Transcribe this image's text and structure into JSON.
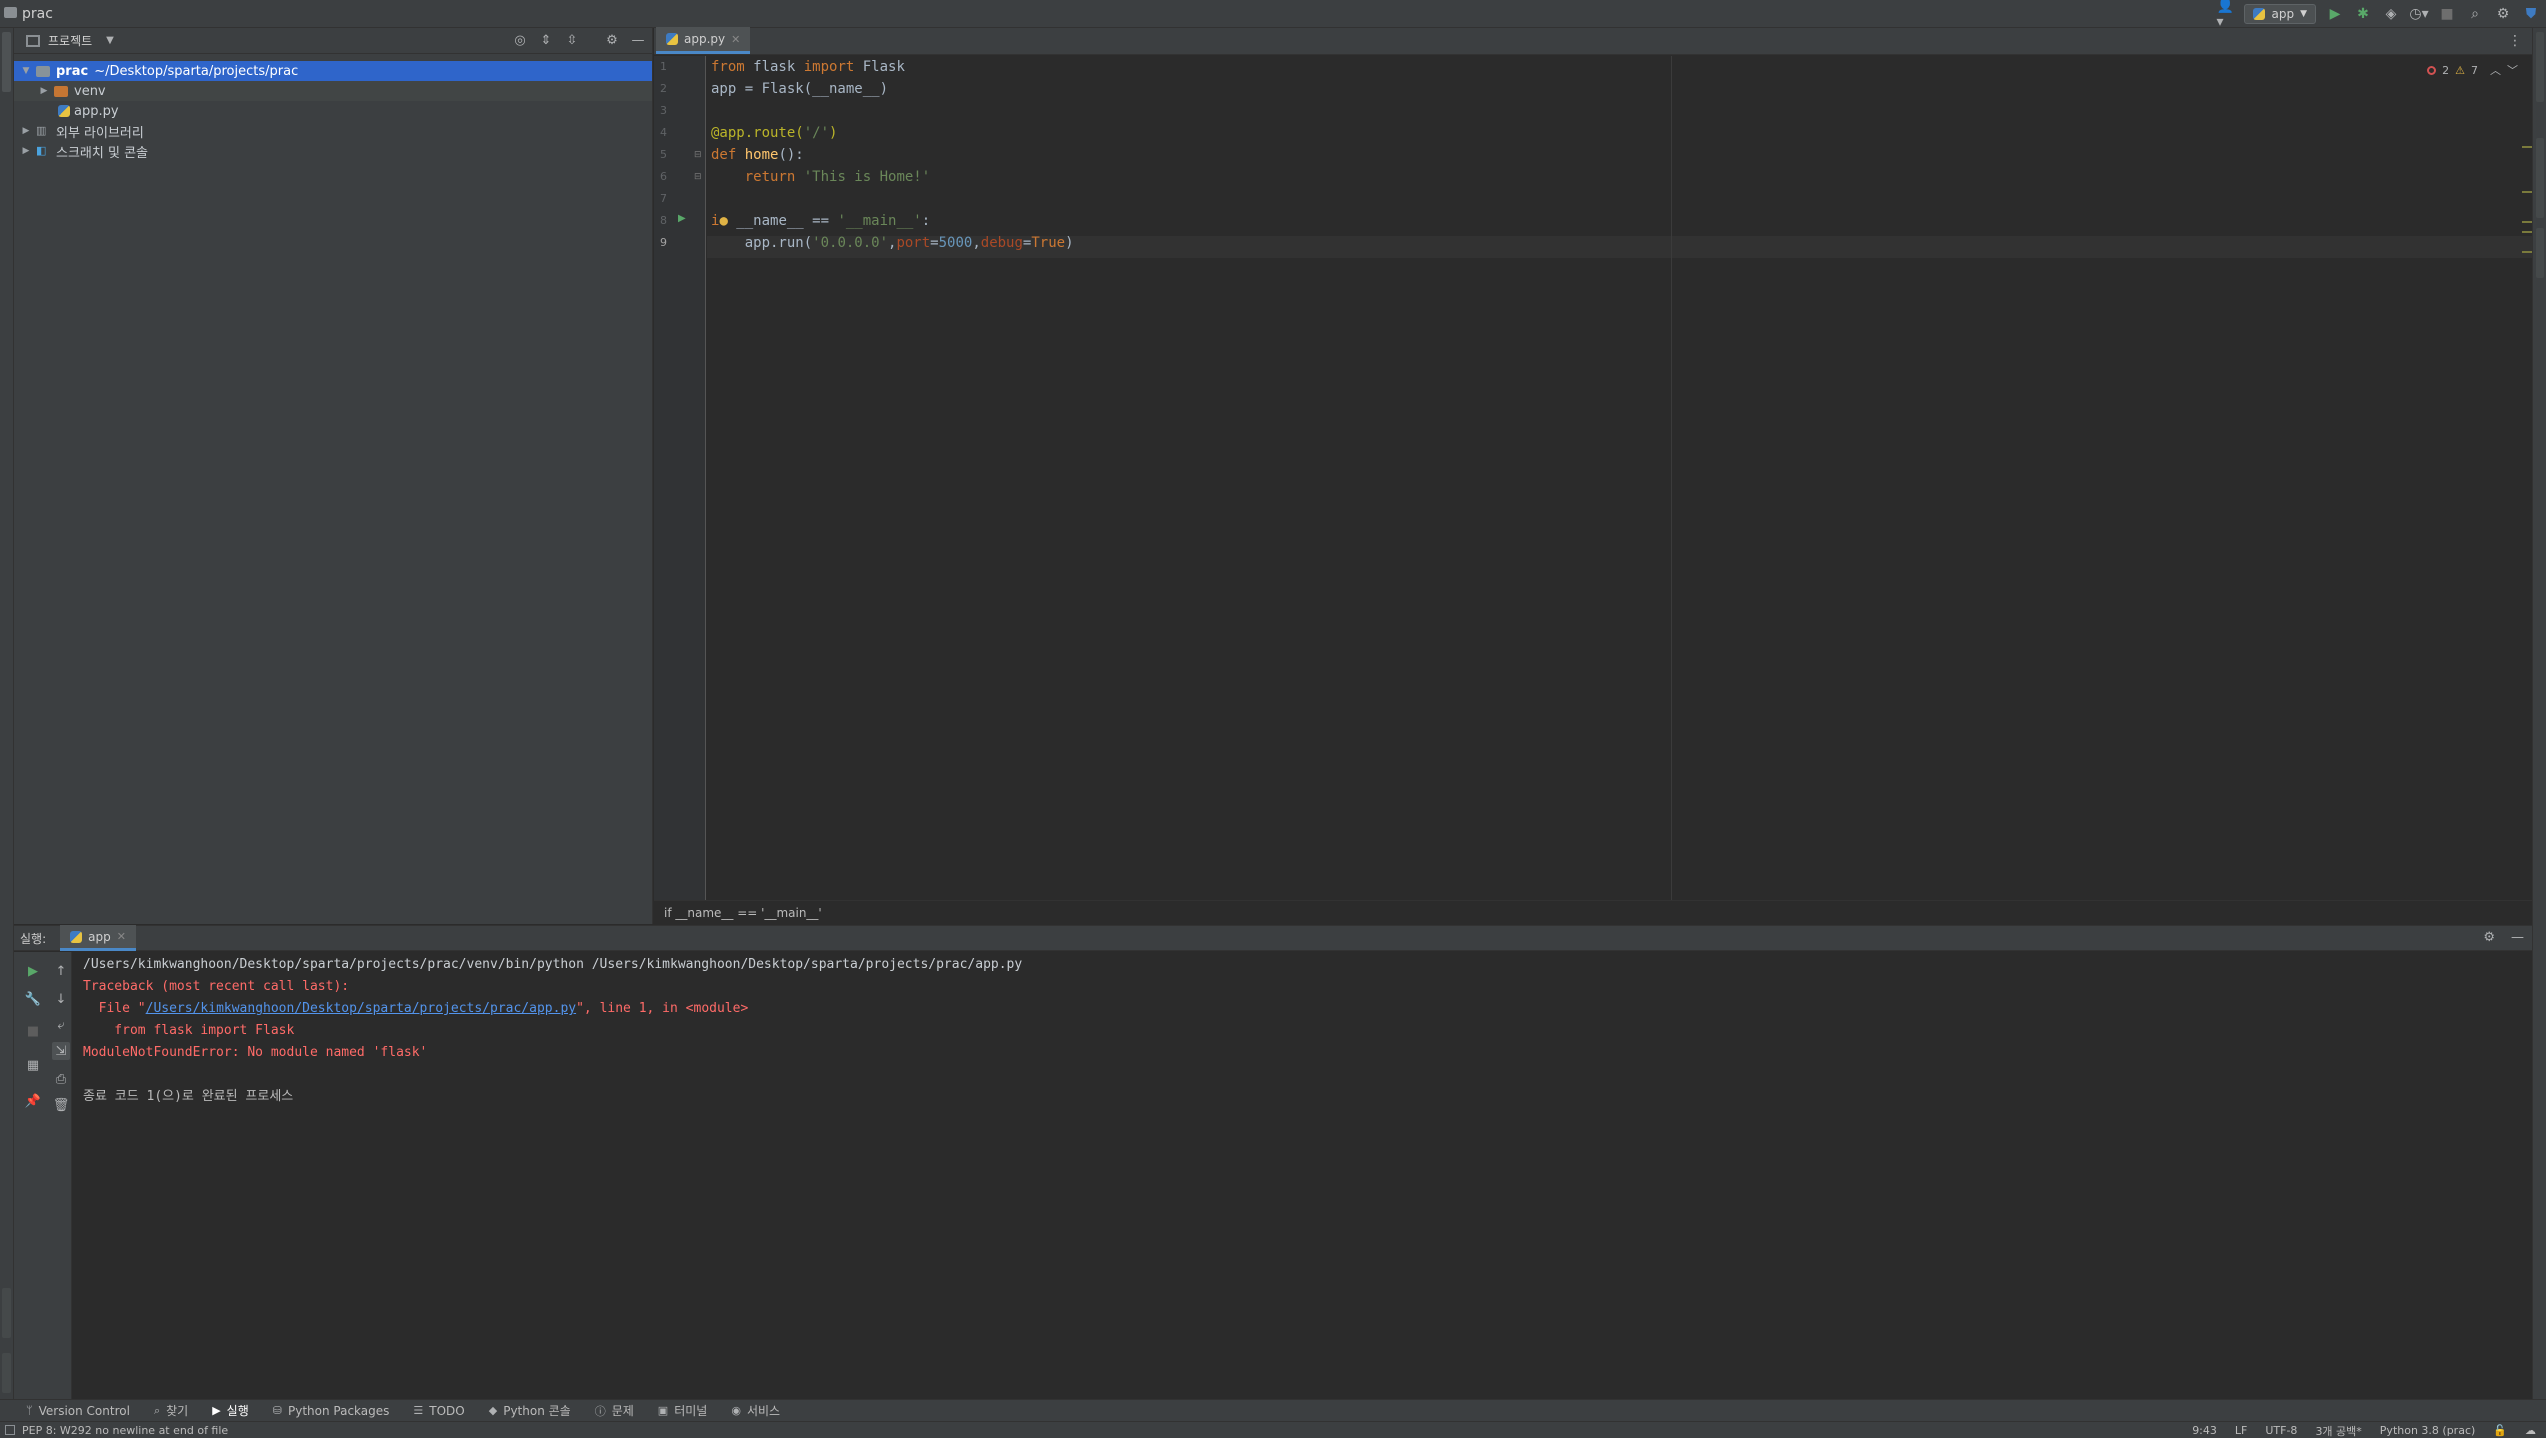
{
  "window": {
    "project_name": "prac"
  },
  "toolbar": {
    "run_config": "app"
  },
  "project_panel": {
    "title": "프로젝트",
    "tree": [
      {
        "label_main": "prac",
        "label_path": "~/Desktop/sparta/projects/prac"
      },
      {
        "label": "venv"
      },
      {
        "label": "app.py"
      },
      {
        "label": "외부 라이브러리"
      },
      {
        "label": "스크래치 및 콘솔"
      }
    ]
  },
  "editor": {
    "tab_label": "app.py",
    "line_numbers": [
      "1",
      "2",
      "3",
      "4",
      "5",
      "6",
      "7",
      "8",
      "9"
    ],
    "inspection": {
      "errors": "2",
      "warnings": "7"
    },
    "breadcrumb": "if __name__ == '__main__'"
  },
  "run_panel": {
    "title": "실행:",
    "tab_label": "app",
    "console": {
      "cmd": "/Users/kimkwanghoon/Desktop/sparta/projects/prac/venv/bin/python /Users/kimkwanghoon/Desktop/sparta/projects/prac/app.py",
      "traceback": "Traceback (most recent call last):",
      "file_prefix": "  File \"",
      "file_link": "/Users/kimkwanghoon/Desktop/sparta/projects/prac/app.py",
      "file_suffix": "\", line 1, in <module>",
      "import_line": "    from flask import Flask",
      "error": "ModuleNotFoundError: No module named 'flask'",
      "exit": "종료 코드 1(으)로 완료된 프로세스"
    }
  },
  "tool_windows": [
    {
      "label": "Version Control"
    },
    {
      "label": "찾기"
    },
    {
      "label": "실행"
    },
    {
      "label": "Python Packages"
    },
    {
      "label": "TODO"
    },
    {
      "label": "Python 콘솔"
    },
    {
      "label": "문제"
    },
    {
      "label": "터미널"
    },
    {
      "label": "서비스"
    }
  ],
  "status_bar": {
    "message": "PEP 8: W292 no newline at end of file",
    "position": "9:43",
    "line_sep": "LF",
    "encoding": "UTF-8",
    "indent": "3개 공백*",
    "interpreter": "Python 3.8 (prac)"
  }
}
